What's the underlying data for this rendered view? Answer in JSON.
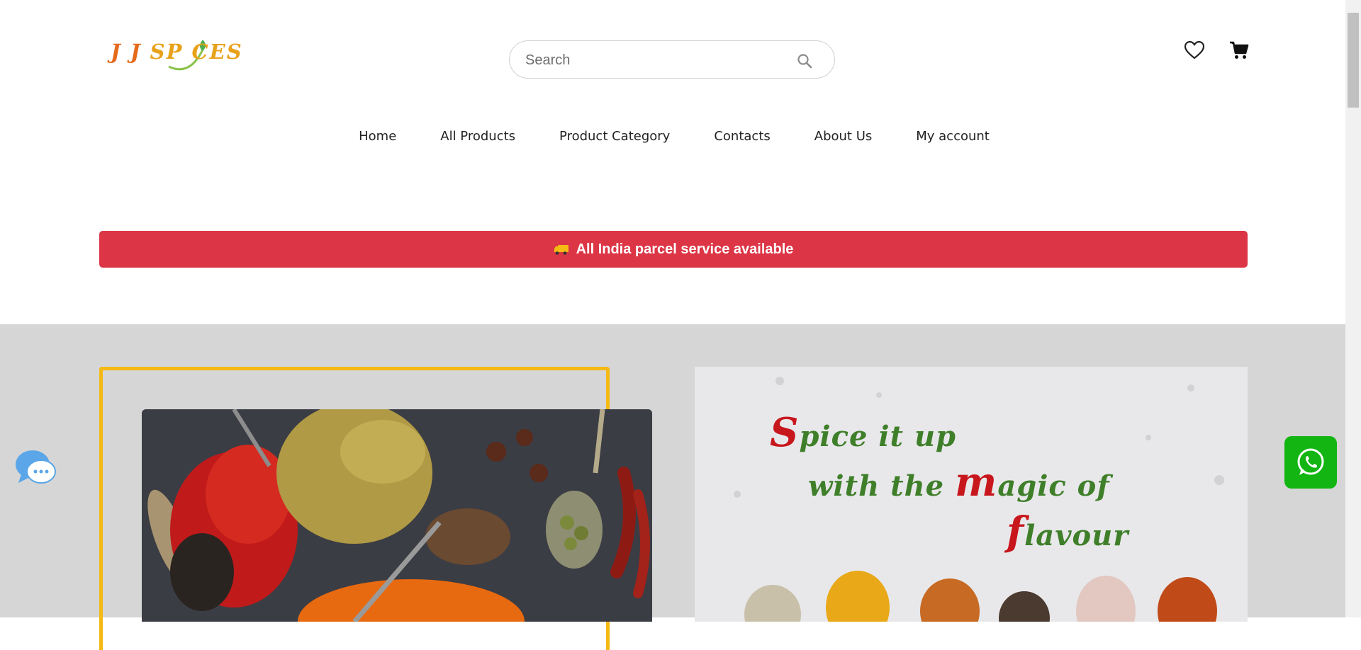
{
  "header": {
    "logo_text": "J J SP CES",
    "search": {
      "placeholder": "Search",
      "value": "",
      "icon": "search-icon"
    },
    "icons": {
      "wishlist": "heart-icon",
      "cart": "cart-icon"
    }
  },
  "nav": {
    "items": [
      {
        "label": "Home"
      },
      {
        "label": "All Products"
      },
      {
        "label": "Product Category"
      },
      {
        "label": "Contacts"
      },
      {
        "label": "About Us"
      },
      {
        "label": "My account"
      }
    ]
  },
  "banner": {
    "text": "All India parcel service available",
    "icon": "truck-icon",
    "color": "#dc3545"
  },
  "hero": {
    "tagline": {
      "line1": {
        "cap": "S",
        "rest": "pice it up"
      },
      "line2": {
        "pre": "with the ",
        "cap": "m",
        "rest": "agic of"
      },
      "line3": {
        "cap": "f",
        "rest": "lavour"
      }
    },
    "frame_color": "#f5b914",
    "background": "#d6d6d6"
  },
  "floating": {
    "chat": "chat-bubble-icon",
    "whatsapp": "whatsapp-icon",
    "whatsapp_color": "#12b512"
  }
}
